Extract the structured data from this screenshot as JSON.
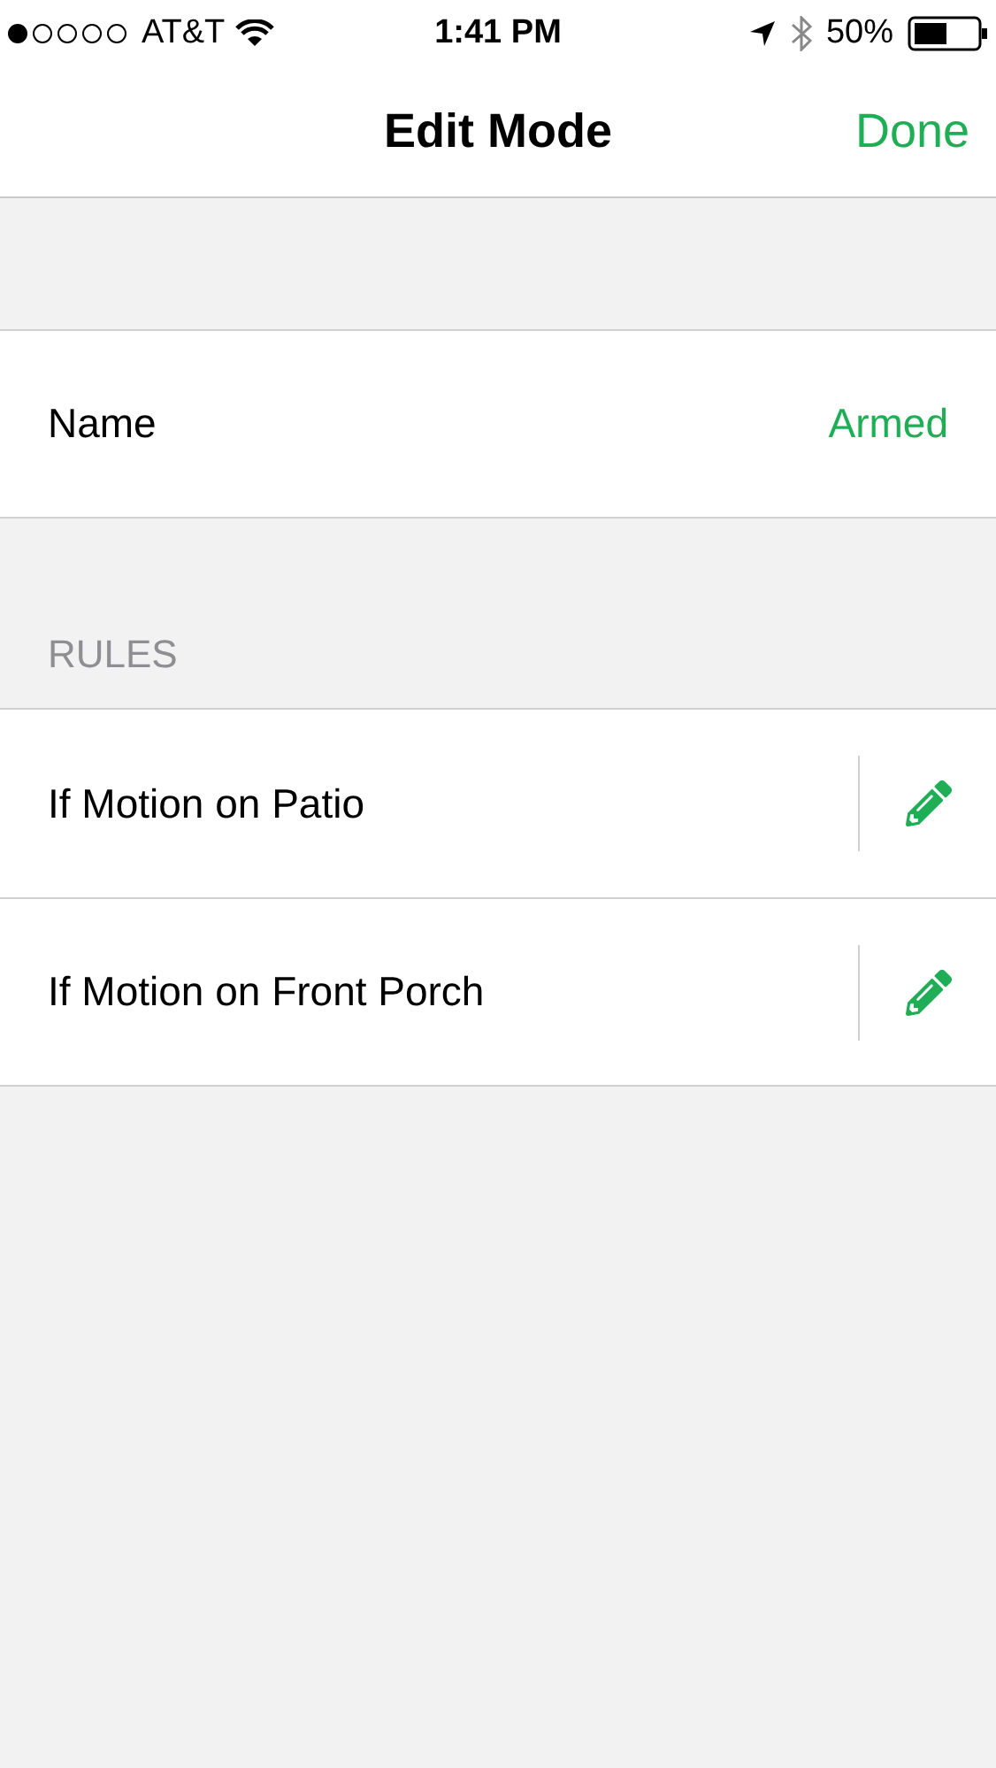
{
  "status_bar": {
    "carrier": "AT&T",
    "time": "1:41 PM",
    "battery": "50%"
  },
  "nav": {
    "title": "Edit Mode",
    "done": "Done"
  },
  "name_row": {
    "label": "Name",
    "value": "Armed"
  },
  "rules": {
    "header": "RULES",
    "items": [
      {
        "label": "If Motion on Patio"
      },
      {
        "label": "If Motion on Front Porch"
      }
    ]
  }
}
